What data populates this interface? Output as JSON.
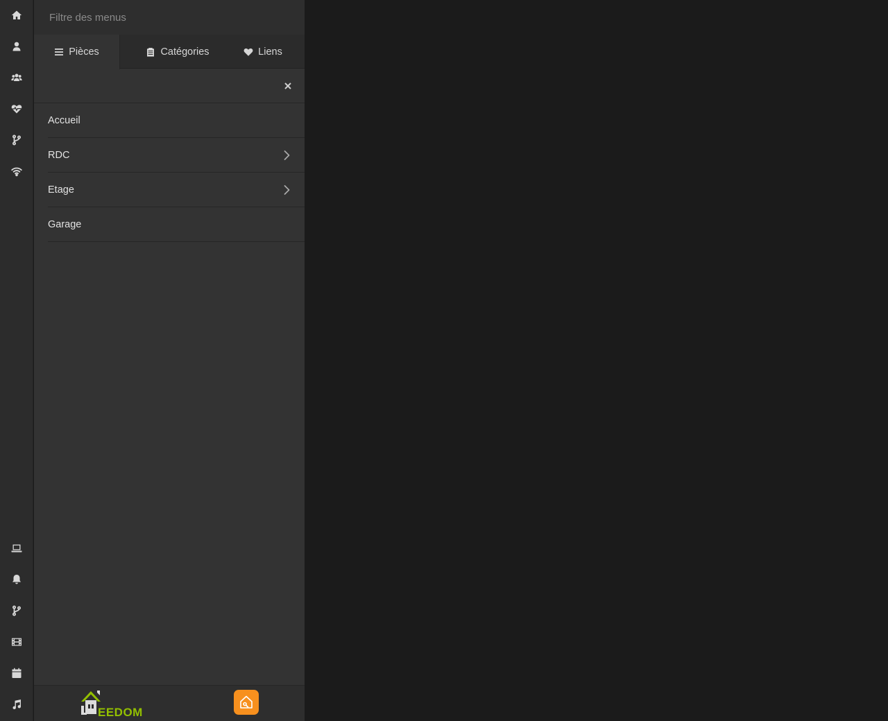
{
  "filter": {
    "placeholder": "Filtre des menus"
  },
  "tabs": [
    {
      "label": "Pièces",
      "icon": "bars-icon",
      "active": true
    },
    {
      "label": "Catégories",
      "icon": "clipboard-icon",
      "active": false
    },
    {
      "label": "Liens",
      "icon": "heart-icon",
      "active": false
    }
  ],
  "rooms": [
    {
      "label": "Accueil",
      "has_children": false
    },
    {
      "label": "RDC",
      "has_children": true
    },
    {
      "label": "Etage",
      "has_children": true
    },
    {
      "label": "Garage",
      "has_children": false
    }
  ],
  "rail_icons_top": [
    "home-icon",
    "user-icon",
    "users-icon",
    "heartbeat-icon",
    "code-branch-icon",
    "wifi-icon"
  ],
  "rail_icons_bottom": [
    "laptop-icon",
    "bell-icon",
    "code-branch-icon",
    "film-icon",
    "calendar-icon",
    "music-icon"
  ],
  "footer": {
    "logo_text": "EEDOM",
    "app_icon": "smarthome-app-icon"
  },
  "colors": {
    "rail_bg": "#2c2c2c",
    "panel_bg": "#333333",
    "content_bg": "#1b1b1b",
    "logo_green": "#93c000",
    "app_orange": "#f7901e"
  }
}
